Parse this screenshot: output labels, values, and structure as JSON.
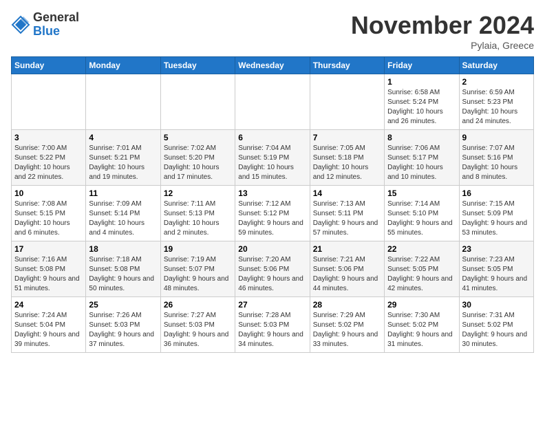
{
  "header": {
    "logo_general": "General",
    "logo_blue": "Blue",
    "month_title": "November 2024",
    "location": "Pylaia, Greece"
  },
  "days_of_week": [
    "Sunday",
    "Monday",
    "Tuesday",
    "Wednesday",
    "Thursday",
    "Friday",
    "Saturday"
  ],
  "weeks": [
    [
      {
        "day": "",
        "info": ""
      },
      {
        "day": "",
        "info": ""
      },
      {
        "day": "",
        "info": ""
      },
      {
        "day": "",
        "info": ""
      },
      {
        "day": "",
        "info": ""
      },
      {
        "day": "1",
        "info": "Sunrise: 6:58 AM\nSunset: 5:24 PM\nDaylight: 10 hours and 26 minutes."
      },
      {
        "day": "2",
        "info": "Sunrise: 6:59 AM\nSunset: 5:23 PM\nDaylight: 10 hours and 24 minutes."
      }
    ],
    [
      {
        "day": "3",
        "info": "Sunrise: 7:00 AM\nSunset: 5:22 PM\nDaylight: 10 hours and 22 minutes."
      },
      {
        "day": "4",
        "info": "Sunrise: 7:01 AM\nSunset: 5:21 PM\nDaylight: 10 hours and 19 minutes."
      },
      {
        "day": "5",
        "info": "Sunrise: 7:02 AM\nSunset: 5:20 PM\nDaylight: 10 hours and 17 minutes."
      },
      {
        "day": "6",
        "info": "Sunrise: 7:04 AM\nSunset: 5:19 PM\nDaylight: 10 hours and 15 minutes."
      },
      {
        "day": "7",
        "info": "Sunrise: 7:05 AM\nSunset: 5:18 PM\nDaylight: 10 hours and 12 minutes."
      },
      {
        "day": "8",
        "info": "Sunrise: 7:06 AM\nSunset: 5:17 PM\nDaylight: 10 hours and 10 minutes."
      },
      {
        "day": "9",
        "info": "Sunrise: 7:07 AM\nSunset: 5:16 PM\nDaylight: 10 hours and 8 minutes."
      }
    ],
    [
      {
        "day": "10",
        "info": "Sunrise: 7:08 AM\nSunset: 5:15 PM\nDaylight: 10 hours and 6 minutes."
      },
      {
        "day": "11",
        "info": "Sunrise: 7:09 AM\nSunset: 5:14 PM\nDaylight: 10 hours and 4 minutes."
      },
      {
        "day": "12",
        "info": "Sunrise: 7:11 AM\nSunset: 5:13 PM\nDaylight: 10 hours and 2 minutes."
      },
      {
        "day": "13",
        "info": "Sunrise: 7:12 AM\nSunset: 5:12 PM\nDaylight: 9 hours and 59 minutes."
      },
      {
        "day": "14",
        "info": "Sunrise: 7:13 AM\nSunset: 5:11 PM\nDaylight: 9 hours and 57 minutes."
      },
      {
        "day": "15",
        "info": "Sunrise: 7:14 AM\nSunset: 5:10 PM\nDaylight: 9 hours and 55 minutes."
      },
      {
        "day": "16",
        "info": "Sunrise: 7:15 AM\nSunset: 5:09 PM\nDaylight: 9 hours and 53 minutes."
      }
    ],
    [
      {
        "day": "17",
        "info": "Sunrise: 7:16 AM\nSunset: 5:08 PM\nDaylight: 9 hours and 51 minutes."
      },
      {
        "day": "18",
        "info": "Sunrise: 7:18 AM\nSunset: 5:08 PM\nDaylight: 9 hours and 50 minutes."
      },
      {
        "day": "19",
        "info": "Sunrise: 7:19 AM\nSunset: 5:07 PM\nDaylight: 9 hours and 48 minutes."
      },
      {
        "day": "20",
        "info": "Sunrise: 7:20 AM\nSunset: 5:06 PM\nDaylight: 9 hours and 46 minutes."
      },
      {
        "day": "21",
        "info": "Sunrise: 7:21 AM\nSunset: 5:06 PM\nDaylight: 9 hours and 44 minutes."
      },
      {
        "day": "22",
        "info": "Sunrise: 7:22 AM\nSunset: 5:05 PM\nDaylight: 9 hours and 42 minutes."
      },
      {
        "day": "23",
        "info": "Sunrise: 7:23 AM\nSunset: 5:05 PM\nDaylight: 9 hours and 41 minutes."
      }
    ],
    [
      {
        "day": "24",
        "info": "Sunrise: 7:24 AM\nSunset: 5:04 PM\nDaylight: 9 hours and 39 minutes."
      },
      {
        "day": "25",
        "info": "Sunrise: 7:26 AM\nSunset: 5:03 PM\nDaylight: 9 hours and 37 minutes."
      },
      {
        "day": "26",
        "info": "Sunrise: 7:27 AM\nSunset: 5:03 PM\nDaylight: 9 hours and 36 minutes."
      },
      {
        "day": "27",
        "info": "Sunrise: 7:28 AM\nSunset: 5:03 PM\nDaylight: 9 hours and 34 minutes."
      },
      {
        "day": "28",
        "info": "Sunrise: 7:29 AM\nSunset: 5:02 PM\nDaylight: 9 hours and 33 minutes."
      },
      {
        "day": "29",
        "info": "Sunrise: 7:30 AM\nSunset: 5:02 PM\nDaylight: 9 hours and 31 minutes."
      },
      {
        "day": "30",
        "info": "Sunrise: 7:31 AM\nSunset: 5:02 PM\nDaylight: 9 hours and 30 minutes."
      }
    ]
  ]
}
